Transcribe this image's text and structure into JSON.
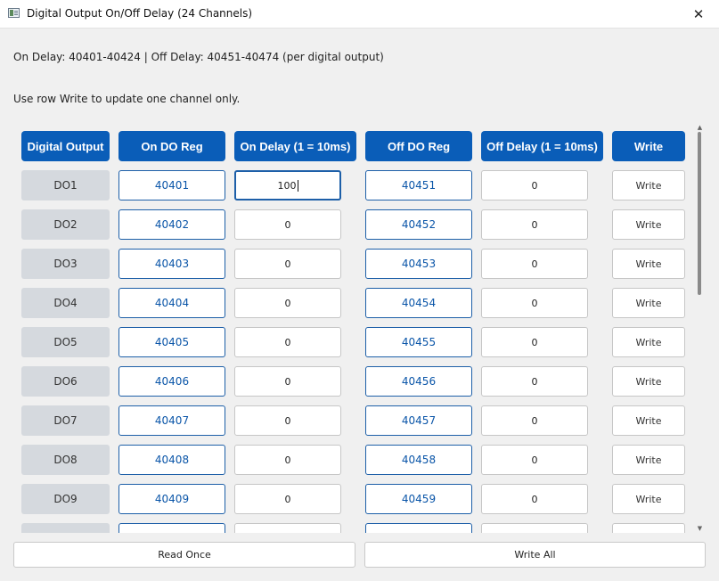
{
  "window": {
    "title": "Digital Output On/Off Delay (24 Channels)",
    "close_glyph": "✕"
  },
  "info": {
    "line1": "On Delay: 40401-40424 | Off Delay: 40451-40474 (per digital output)",
    "line2": "Use row Write to update one channel only."
  },
  "table": {
    "headers": [
      "Digital Output",
      "On DO Reg",
      "On Delay (1 = 10ms)",
      "Off DO Reg",
      "Off Delay (1 = 10ms)",
      "Write"
    ],
    "rows": [
      {
        "do": "DO1",
        "on_reg": "40401",
        "on_delay": "100",
        "off_reg": "40451",
        "off_delay": "0",
        "write": "Write"
      },
      {
        "do": "DO2",
        "on_reg": "40402",
        "on_delay": "0",
        "off_reg": "40452",
        "off_delay": "0",
        "write": "Write"
      },
      {
        "do": "DO3",
        "on_reg": "40403",
        "on_delay": "0",
        "off_reg": "40453",
        "off_delay": "0",
        "write": "Write"
      },
      {
        "do": "DO4",
        "on_reg": "40404",
        "on_delay": "0",
        "off_reg": "40454",
        "off_delay": "0",
        "write": "Write"
      },
      {
        "do": "DO5",
        "on_reg": "40405",
        "on_delay": "0",
        "off_reg": "40455",
        "off_delay": "0",
        "write": "Write"
      },
      {
        "do": "DO6",
        "on_reg": "40406",
        "on_delay": "0",
        "off_reg": "40456",
        "off_delay": "0",
        "write": "Write"
      },
      {
        "do": "DO7",
        "on_reg": "40407",
        "on_delay": "0",
        "off_reg": "40457",
        "off_delay": "0",
        "write": "Write"
      },
      {
        "do": "DO8",
        "on_reg": "40408",
        "on_delay": "0",
        "off_reg": "40458",
        "off_delay": "0",
        "write": "Write"
      },
      {
        "do": "DO9",
        "on_reg": "40409",
        "on_delay": "0",
        "off_reg": "40459",
        "off_delay": "0",
        "write": "Write"
      }
    ]
  },
  "scrollbar": {
    "up_glyph": "▲",
    "down_glyph": "▼"
  },
  "buttons": {
    "read_once": "Read Once",
    "write_all": "Write All"
  }
}
